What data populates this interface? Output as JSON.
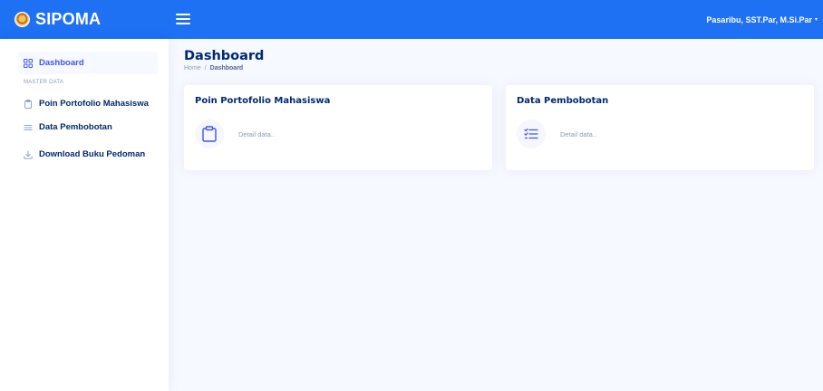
{
  "header": {
    "app_name": "SIPOMA",
    "logo_icon": "sipoma-logo",
    "menu_icon": "hamburger-menu-icon",
    "user_name": "Pasaribu, SST.Par, M.Si.Par",
    "user_caret": "▾",
    "color": "#1d71f2"
  },
  "sidebar": {
    "heading": "MASTER DATA",
    "items": [
      {
        "label": "Dashboard",
        "icon": "grid-icon",
        "active": true
      },
      {
        "label": "Poin Portofolio Mahasiswa",
        "icon": "clipboard-icon",
        "active": false
      },
      {
        "label": "Data Pembobotan",
        "icon": "list-icon",
        "active": false
      },
      {
        "label": "Download Buku Pedoman",
        "icon": "download-icon",
        "active": false
      }
    ]
  },
  "main": {
    "page_title": "Dashboard",
    "breadcrumb": {
      "home": "Home",
      "separator": "/",
      "current": "Dashboard"
    },
    "cards": [
      {
        "title": "Poin Portofolio Mahasiswa",
        "icon": "clipboard-icon",
        "link_label": "Detail data.."
      },
      {
        "title": "Data Pembobotan",
        "icon": "checklist-icon",
        "link_label": "Detail data.."
      }
    ]
  },
  "colors": {
    "accent": "#4154f1",
    "navy": "#012970",
    "muted": "#899bbd",
    "background": "#f6f9ff"
  }
}
